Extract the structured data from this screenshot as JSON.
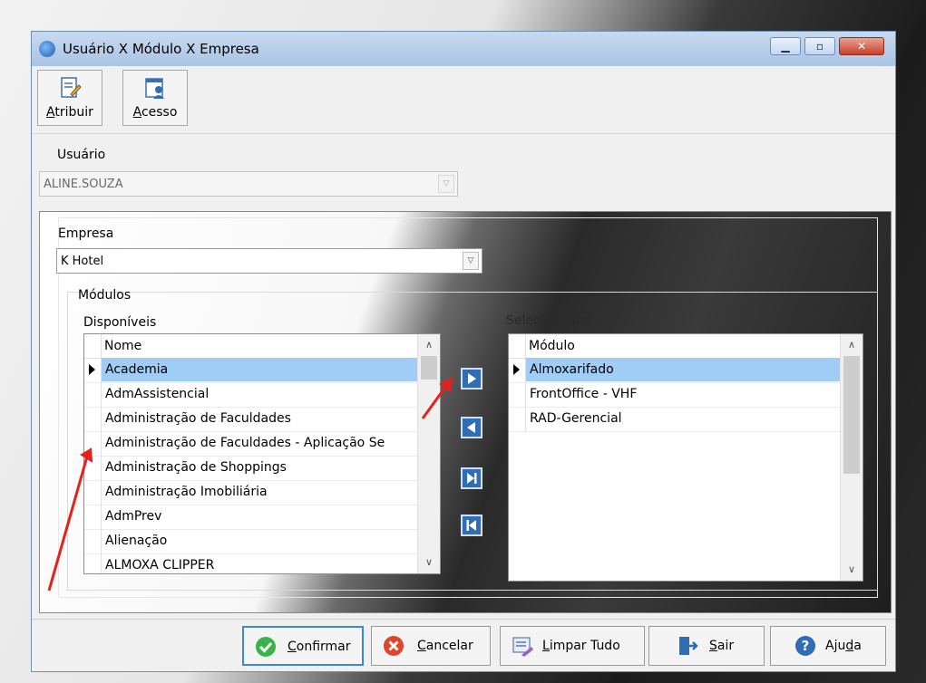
{
  "window": {
    "title": "Usuário X Módulo X Empresa"
  },
  "toolbar": {
    "atribuir": {
      "accel": "A",
      "rest": "tribuir"
    },
    "acesso": {
      "accel": "A",
      "rest": "cesso"
    }
  },
  "usuario": {
    "label": "Usuário",
    "value": "ALINE.SOUZA"
  },
  "empresa": {
    "label": "Empresa",
    "value": "K Hotel"
  },
  "modulos": {
    "label": "Módulos",
    "disponiveis": {
      "label": "Disponíveis",
      "column": "Nome",
      "items": [
        "Academia",
        "AdmAssistencial",
        "Administração de Faculdades",
        "Administração de Faculdades - Aplicação Se",
        "Administração de Shoppings",
        "Administração Imobiliária",
        "AdmPrev",
        "Alienação",
        "ALMOXA CLIPPER"
      ],
      "selected_index": 0
    },
    "selecionados": {
      "label": "Selecionados",
      "column": "Módulo",
      "items": [
        "Almoxarifado",
        "FrontOffice - VHF",
        "RAD-Gerencial"
      ],
      "selected_index": 0
    }
  },
  "buttons": {
    "confirmar": {
      "accel": "C",
      "rest": "onfirmar"
    },
    "cancelar": {
      "accel": "C",
      "rest": "ancelar"
    },
    "limpar": {
      "accel": "L",
      "rest": "impar Tudo"
    },
    "sair": {
      "accel": "S",
      "rest": "air"
    },
    "ajuda": {
      "pre": "Aju",
      "accel": "d",
      "rest": "a"
    }
  },
  "icons": [
    "app-globe-icon",
    "edit-document-icon",
    "user-access-icon",
    "check-circle-icon",
    "cancel-x-icon",
    "clear-all-icon",
    "exit-door-icon",
    "help-question-icon",
    "move-right-icon",
    "move-left-icon",
    "move-all-right-icon",
    "move-all-left-icon"
  ],
  "colors": {
    "accent_blue": "#2f6db5",
    "selection": "#9fcdf5",
    "annotation_red": "#e8201c"
  }
}
